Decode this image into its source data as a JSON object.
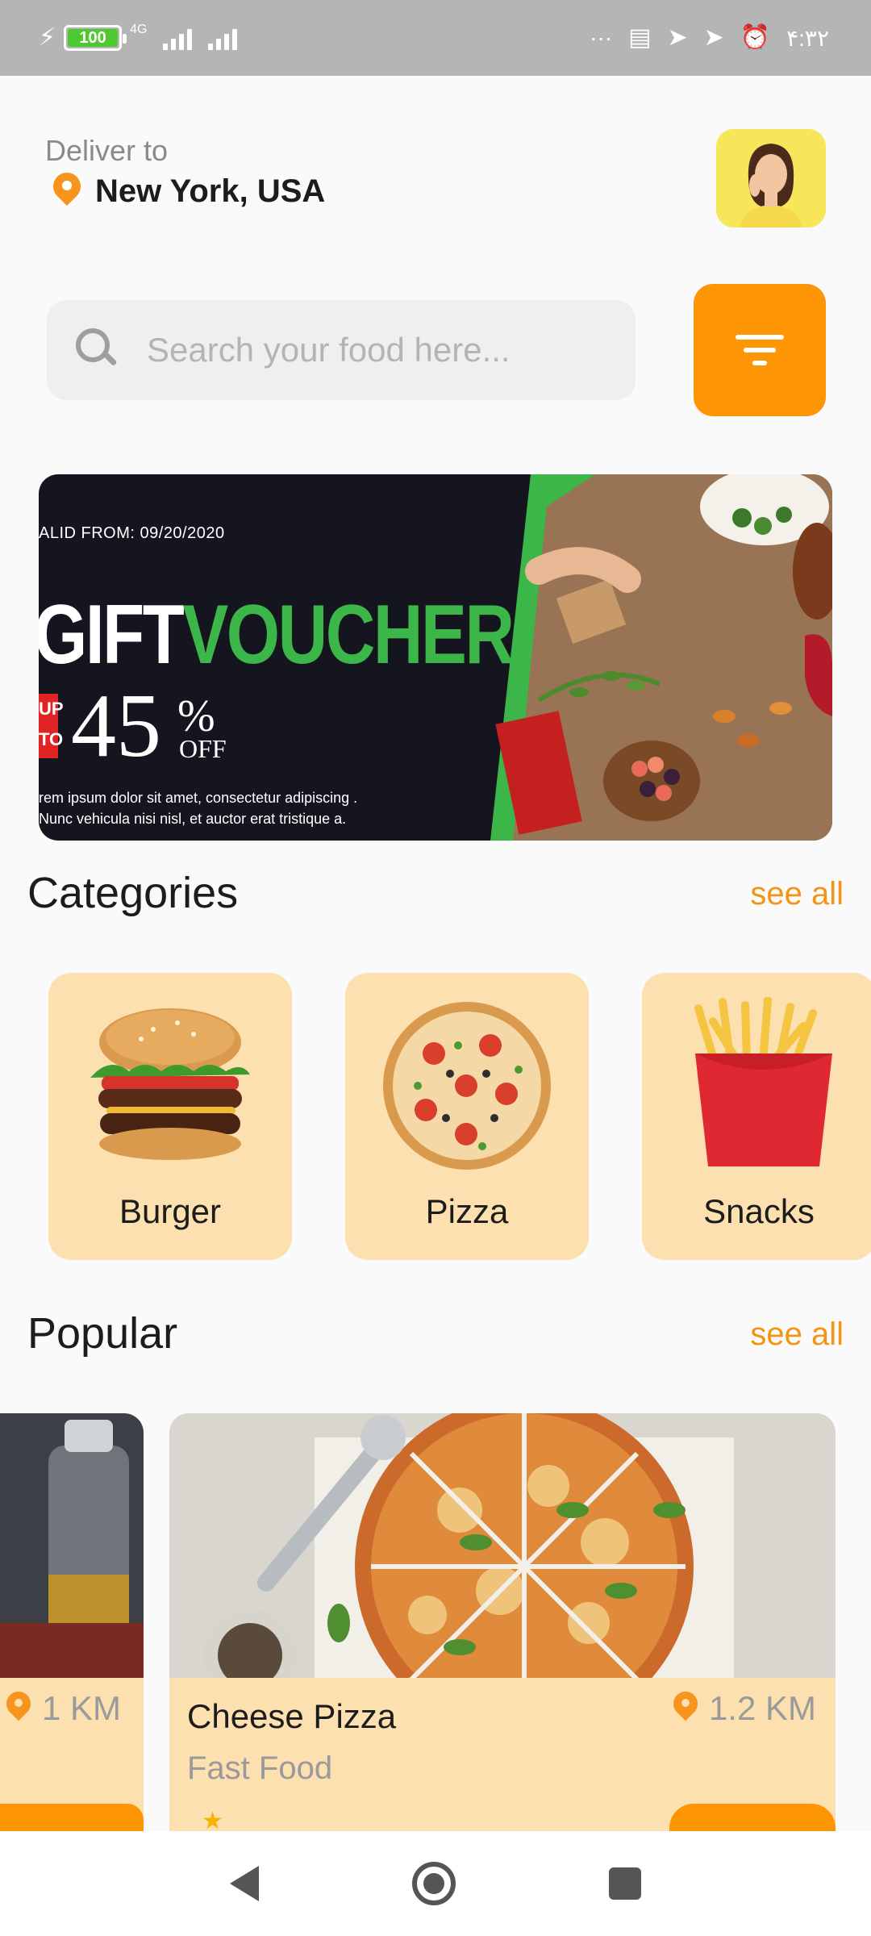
{
  "status_bar": {
    "battery": "100",
    "network": "4G",
    "overflow": "···",
    "time": "۴:۳۲",
    "icons": [
      "charging-icon",
      "battery-icon",
      "signal-icon",
      "message-icon",
      "telegram-icon",
      "telegram-icon",
      "alarm-icon"
    ]
  },
  "header": {
    "deliver_label": "Deliver to",
    "location": "New York, USA",
    "location_icon": "pin-icon"
  },
  "search": {
    "placeholder": "Search your food here..."
  },
  "banner": {
    "valid_from": "ALID FROM: 09/20/2020",
    "title_part1": "GIFT",
    "title_part2": "VOUCHER",
    "tag": "UP TO",
    "discount": "45",
    "percent": "%",
    "off": "OFF",
    "description": "rem ipsum dolor sit amet, consectetur adipiscing . Nunc vehicula nisi nisl, et auctor erat tristique a."
  },
  "categories": {
    "title": "Categories",
    "see_all": "see all",
    "items": [
      {
        "label": "Burger"
      },
      {
        "label": "Pizza"
      },
      {
        "label": "Snacks"
      }
    ]
  },
  "popular": {
    "title": "Popular",
    "see_all": "see all",
    "items": [
      {
        "distance": "1 KM"
      },
      {
        "name": "Cheese Pizza",
        "type": "Fast Food",
        "distance": "1.2 KM"
      }
    ]
  },
  "colors": {
    "accent": "#fd9505",
    "card_bg": "#fde0b0",
    "voucher_green": "#3db649"
  }
}
